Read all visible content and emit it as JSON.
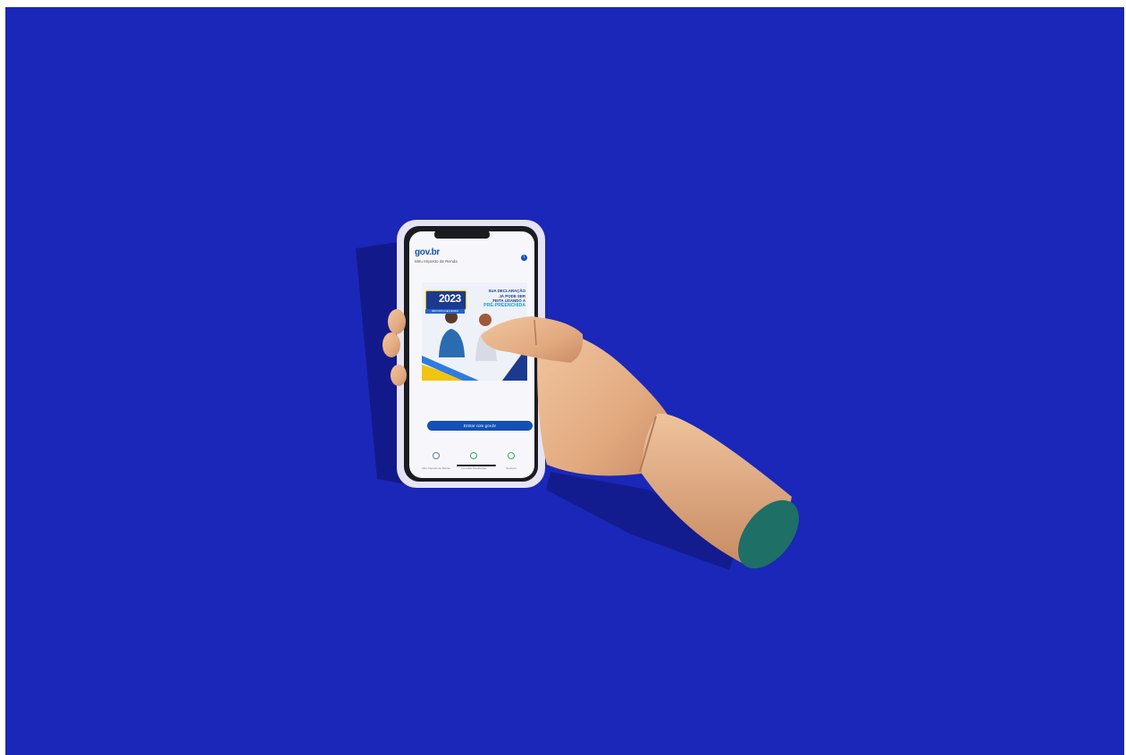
{
  "colors": {
    "background": "#1a27b8",
    "phone_case": "#e6e3f2",
    "wood": "#e8b48c",
    "cut_end": "#1e6f66",
    "gov_blue": "#1351b4"
  },
  "phone_screen": {
    "logo_text": "gov.br",
    "subtitle": "Meu Imposto de Renda",
    "info_icon": "i",
    "banner": {
      "year": "2023",
      "year_caption": "IMPOSTO DE RENDA",
      "headline_lines": [
        "SUA DECLARAÇÃO",
        "JÁ PODE SER",
        "FEITA USANDO A"
      ],
      "headline_highlight": "PRÉ-PREENCHIDA"
    },
    "cta_label": "Entrar com gov.br",
    "nav_items": [
      {
        "icon": "shield-icon",
        "label": "Meu Imposto de Renda"
      },
      {
        "icon": "dollar-icon",
        "label": "Consultar Restituição"
      },
      {
        "icon": "plus-icon",
        "label": "Serviços"
      }
    ]
  }
}
